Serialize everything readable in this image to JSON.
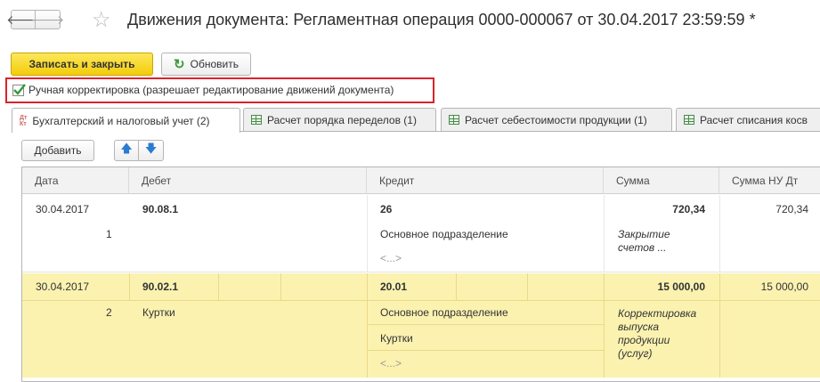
{
  "header": {
    "title": "Движения документа: Регламентная операция 0000-000067 от 30.04.2017 23:59:59 *",
    "back_glyph": "🡐",
    "forward_glyph": "🡒",
    "star_glyph": "☆"
  },
  "toolbar": {
    "save_close_label": "Записать и закрыть",
    "refresh_label": "Обновить"
  },
  "manual_correction": {
    "checked": true,
    "label": "Ручная корректировка (разрешает редактирование движений документа)"
  },
  "tabs": [
    {
      "label": "Бухгалтерский и налоговый учет (2)",
      "icon": "dt-kt-icon",
      "active": true
    },
    {
      "label": "Расчет порядка переделов (1)",
      "icon": "table-icon",
      "active": false
    },
    {
      "label": "Расчет себестоимости продукции (1)",
      "icon": "table-icon",
      "active": false
    },
    {
      "label": "Расчет списания косв",
      "icon": "table-icon",
      "active": false
    }
  ],
  "table_toolbar": {
    "add_label": "Добавить",
    "up_glyph": "🡅",
    "down_glyph": "🡇"
  },
  "table": {
    "columns": [
      "Дата",
      "Дебет",
      "Кредит",
      "Сумма",
      "Сумма НУ Дт"
    ],
    "rows": [
      {
        "date": "30.04.2017",
        "number": "1",
        "debit_account": "90.08.1",
        "debit_sub1": "",
        "credit_account": "26",
        "credit_sub1": "Основное подразделение",
        "credit_sub2": "",
        "credit_more": "<...>",
        "amount": "720,34",
        "content": "Закрытие счетов ...",
        "amount_nu_dt": "720,34"
      },
      {
        "date": "30.04.2017",
        "number": "2",
        "debit_account": "90.02.1",
        "debit_sub1": "Куртки",
        "credit_account": "20.01",
        "credit_sub1": "Основное подразделение",
        "credit_sub2": "Куртки",
        "credit_more": "<...>",
        "amount": "15 000,00",
        "content": "Корректировка выпуска продукции (услуг)",
        "amount_nu_dt": "15 000,00"
      }
    ]
  },
  "colors": {
    "primary_button": "#f3cc0a",
    "highlight_border": "#d9232a",
    "selected_row": "#fbf2b0",
    "accent_blue": "#2b7bd1"
  }
}
